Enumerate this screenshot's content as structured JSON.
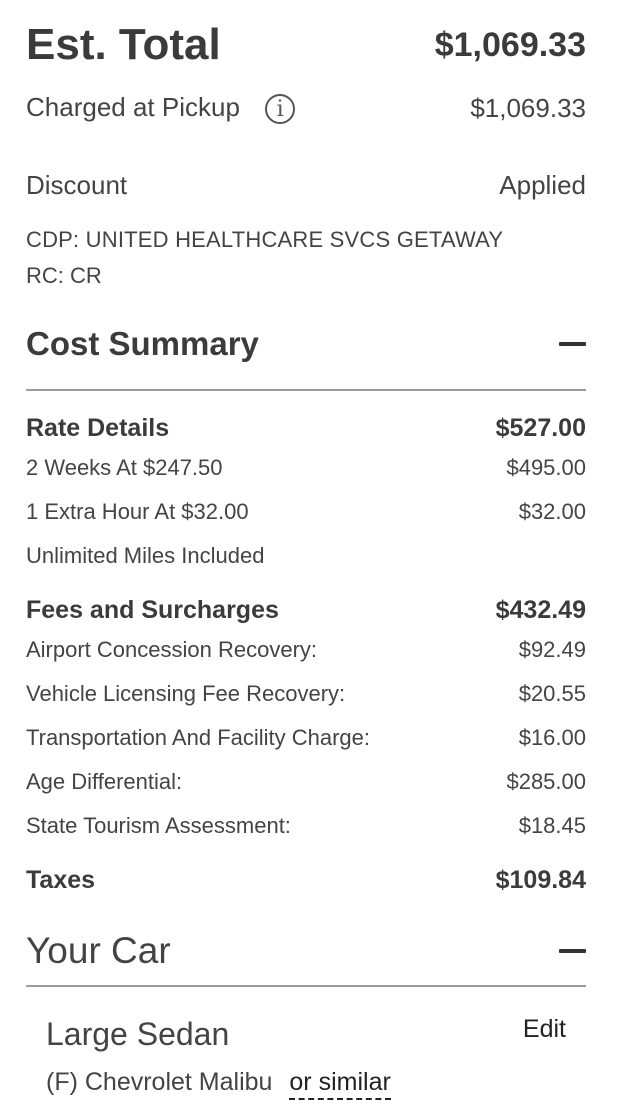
{
  "estimate": {
    "title": "Est. Total",
    "total": "$1,069.33",
    "charged_label": "Charged at Pickup",
    "charged_value": "$1,069.33",
    "discount_label": "Discount",
    "discount_value": "Applied",
    "code_cdp": "CDP: UNITED HEALTHCARE SVCS GETAWAY",
    "code_rc": "RC: CR"
  },
  "cost_summary": {
    "title": "Cost Summary",
    "rate_details": {
      "label": "Rate Details",
      "total": "$527.00",
      "items": [
        {
          "label": "2 Weeks At $247.50",
          "value": "$495.00"
        },
        {
          "label": "1 Extra Hour At $32.00",
          "value": "$32.00"
        },
        {
          "label": "Unlimited Miles Included",
          "value": ""
        }
      ]
    },
    "fees": {
      "label": "Fees and Surcharges",
      "total": "$432.49",
      "items": [
        {
          "label": "Airport Concession Recovery:",
          "value": "$92.49"
        },
        {
          "label": "Vehicle Licensing Fee Recovery:",
          "value": "$20.55"
        },
        {
          "label": "Transportation And Facility Charge:",
          "value": "$16.00"
        },
        {
          "label": "Age Differential:",
          "value": "$285.00"
        },
        {
          "label": "State Tourism Assessment:",
          "value": "$18.45"
        }
      ]
    },
    "taxes": {
      "label": "Taxes",
      "total": "$109.84"
    }
  },
  "your_car": {
    "title": "Your Car",
    "car_class": "Large Sedan",
    "edit_label": "Edit",
    "model": "(F) Chevrolet Malibu",
    "similar_label": "or similar"
  },
  "icons": {
    "info": "info-icon",
    "collapse": "minus-icon"
  }
}
